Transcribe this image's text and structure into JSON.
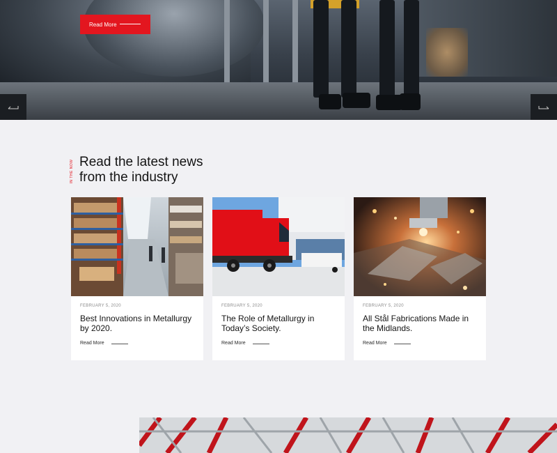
{
  "hero": {
    "cta_label": "Read More",
    "prev_icon": "arrow-left-icon",
    "next_icon": "arrow-right-icon"
  },
  "news": {
    "eyebrow": "In the now",
    "title_line1": "Read the latest news",
    "title_line2": "from the industry",
    "cards": [
      {
        "image": "warehouse-photo",
        "date": "FEBRUARY 5, 2020",
        "title": "Best Innovations in Metallurgy by 2020.",
        "cta": "Read More"
      },
      {
        "image": "red-truck-photo",
        "date": "FEBRUARY 5, 2020",
        "title": "The Role of Metallurgy in Today’s Society.",
        "cta": "Read More"
      },
      {
        "image": "laser-cutting-photo",
        "date": "FEBRUARY 5, 2020",
        "title": "All Stål Fabrications Made in the Midlands.",
        "cta": "Read More"
      }
    ]
  },
  "colors": {
    "accent": "#e3161f",
    "page_bg": "#f1f1f4",
    "card_bg": "#ffffff",
    "heading": "#141414"
  }
}
